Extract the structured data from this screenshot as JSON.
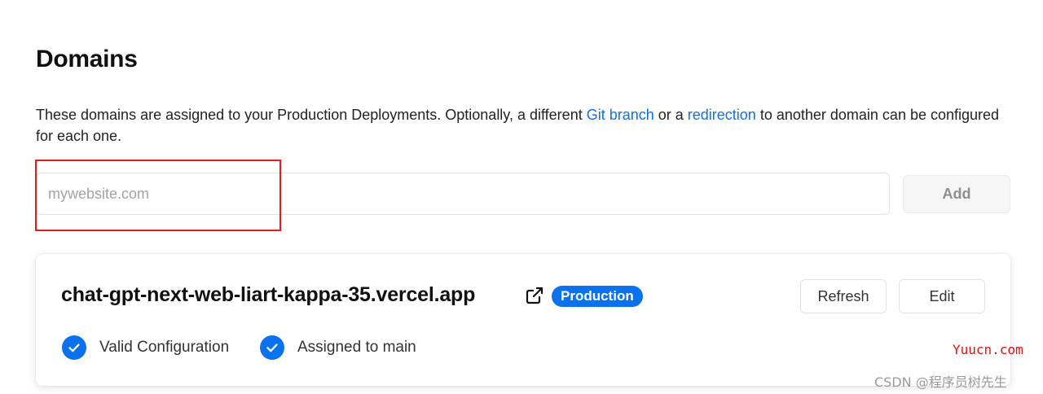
{
  "page": {
    "title": "Domains",
    "description": {
      "text_before": "These domains are assigned to your Production Deployments. Optionally, a different ",
      "link_git_branch": "Git branch",
      "text_middle": " or a ",
      "link_redirection": "redirection",
      "text_after": " to another domain can be configured for each one."
    }
  },
  "add_domain": {
    "input_value": "",
    "placeholder": "mywebsite.com",
    "add_label": "Add"
  },
  "domain_card": {
    "domain": "chat-gpt-next-web-liart-kappa-35.vercel.app",
    "external_link_icon": "external-link-icon",
    "badge": "Production",
    "refresh_label": "Refresh",
    "edit_label": "Edit",
    "statuses": [
      {
        "icon": "check-circle-icon",
        "label": "Valid Configuration"
      },
      {
        "icon": "check-circle-icon",
        "label": "Assigned to main"
      }
    ]
  },
  "watermarks": {
    "site": "Yuucn.com",
    "author": "CSDN @程序员树先生"
  },
  "colors": {
    "link": "#0a72ef",
    "badge": "#0a72ef",
    "check": "#0a72ef",
    "highlight_box": "#e51b1b"
  }
}
